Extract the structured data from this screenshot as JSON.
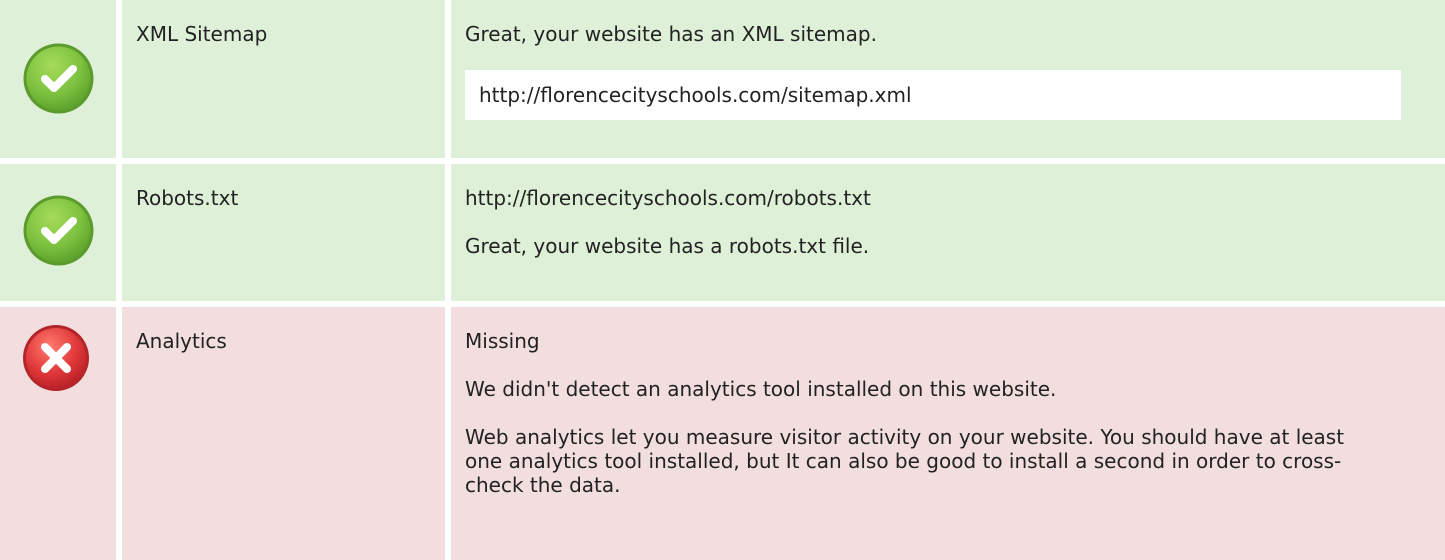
{
  "checks": [
    {
      "status": "pass",
      "status_icon": "green-checkmark-icon",
      "name": "XML Sitemap",
      "message": "Great, your website has an XML sitemap.",
      "url": "http://florencecityschools.com/sitemap.xml"
    },
    {
      "status": "pass",
      "status_icon": "green-checkmark-icon",
      "name": "Robots.txt",
      "url": "http://florencecityschools.com/robots.txt",
      "message": "Great, your website has a robots.txt file."
    },
    {
      "status": "fail",
      "status_icon": "red-cross-icon",
      "name": "Analytics",
      "result": "Missing",
      "message": "We didn't detect an analytics tool installed on this website.",
      "explanation": "Web analytics let you measure visitor activity on your website. You should have at least one analytics tool installed, but It can also be good to install a second in order to cross-check the data."
    }
  ],
  "colors": {
    "pass_background": "#dff0d8",
    "fail_background": "#f2dede",
    "pass_icon": "#7cc13f",
    "fail_icon": "#e0383a"
  }
}
